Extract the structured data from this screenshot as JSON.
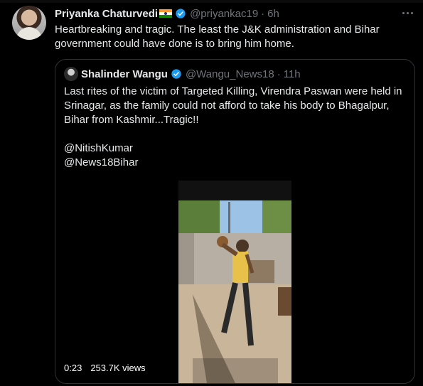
{
  "author": {
    "name": "Priyanka Chaturvedi",
    "handle": "@priyankac19",
    "separator": "·",
    "time": "6h",
    "flag_icon": "india-flag-icon",
    "verified_icon": "verified-badge-icon"
  },
  "tweet": {
    "lines": [
      "Heartbreaking and tragic. The least the J&K administration and Bihar",
      "government could have done is to bring him home."
    ]
  },
  "quoted": {
    "name": "Shalinder Wangu",
    "handle": "@Wangu_News18",
    "separator": "·",
    "time": "11h",
    "lines": [
      "Last rites of the victim of Targeted Killing, Virendra Paswan were held in",
      "Srinagar, as the family could not afford to take his body to Bhagalpur,",
      "Bihar from Kashmir...Tragic!!",
      "",
      "@NitishKumar",
      "@News18Bihar"
    ],
    "video": {
      "duration": "0:23",
      "views": "253.7K views"
    }
  },
  "colors": {
    "background": "#000000",
    "text": "#e7e9ea",
    "muted": "#71767b",
    "border": "#2f3336",
    "verified": "#1d9bf0"
  }
}
